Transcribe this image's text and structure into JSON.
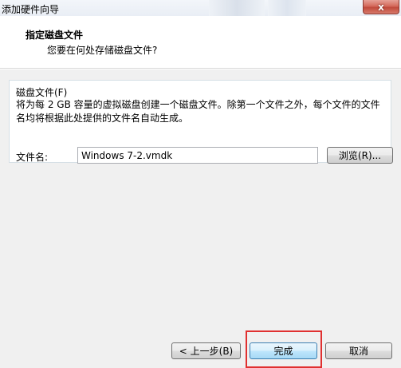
{
  "window": {
    "title": "添加硬件向导"
  },
  "titlebar": {
    "close_label": "x"
  },
  "header": {
    "title": "指定磁盘文件",
    "subtitle": "您要在何处存储磁盘文件?"
  },
  "disk_file_group": {
    "label": "磁盘文件(F)",
    "description": "将为每 2 GB 容量的虚拟磁盘创建一个磁盘文件。除第一个文件之外，每个文件的文件名均将根据此处提供的文件名自动生成。",
    "filename_label": "文件名:",
    "filename_value": "Windows 7-2.vmdk",
    "browse_label": "浏览(R)..."
  },
  "footer": {
    "back_label": "< 上一步(B)",
    "finish_label": "完成",
    "cancel_label": "取消"
  }
}
